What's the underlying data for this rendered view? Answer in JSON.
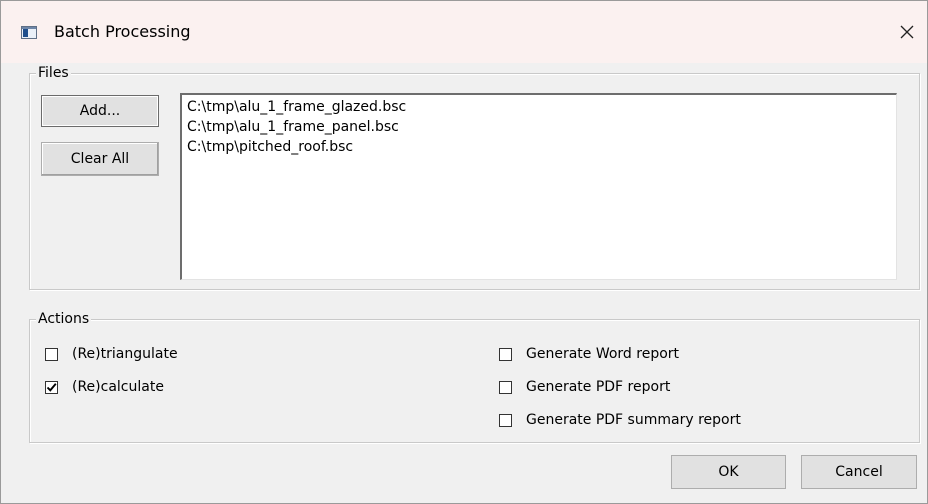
{
  "window": {
    "title": "Batch Processing",
    "close_glyph": "✕"
  },
  "files": {
    "group_label": "Files",
    "add_label": "Add...",
    "clear_label": "Clear All",
    "items": [
      "C:\\tmp\\alu_1_frame_glazed.bsc",
      "C:\\tmp\\alu_1_frame_panel.bsc",
      "C:\\tmp\\pitched_roof.bsc"
    ]
  },
  "actions": {
    "group_label": "Actions",
    "left": [
      {
        "label": "(Re)triangulate",
        "checked": false
      },
      {
        "label": "(Re)calculate",
        "checked": true
      }
    ],
    "right": [
      {
        "label": "Generate Word report",
        "checked": false
      },
      {
        "label": "Generate PDF report",
        "checked": false
      },
      {
        "label": "Generate PDF summary report",
        "checked": false
      }
    ]
  },
  "footer": {
    "ok_label": "OK",
    "cancel_label": "Cancel"
  },
  "icons": {
    "window": "window-app-icon",
    "close": "close-icon",
    "check": "checkmark-icon"
  }
}
